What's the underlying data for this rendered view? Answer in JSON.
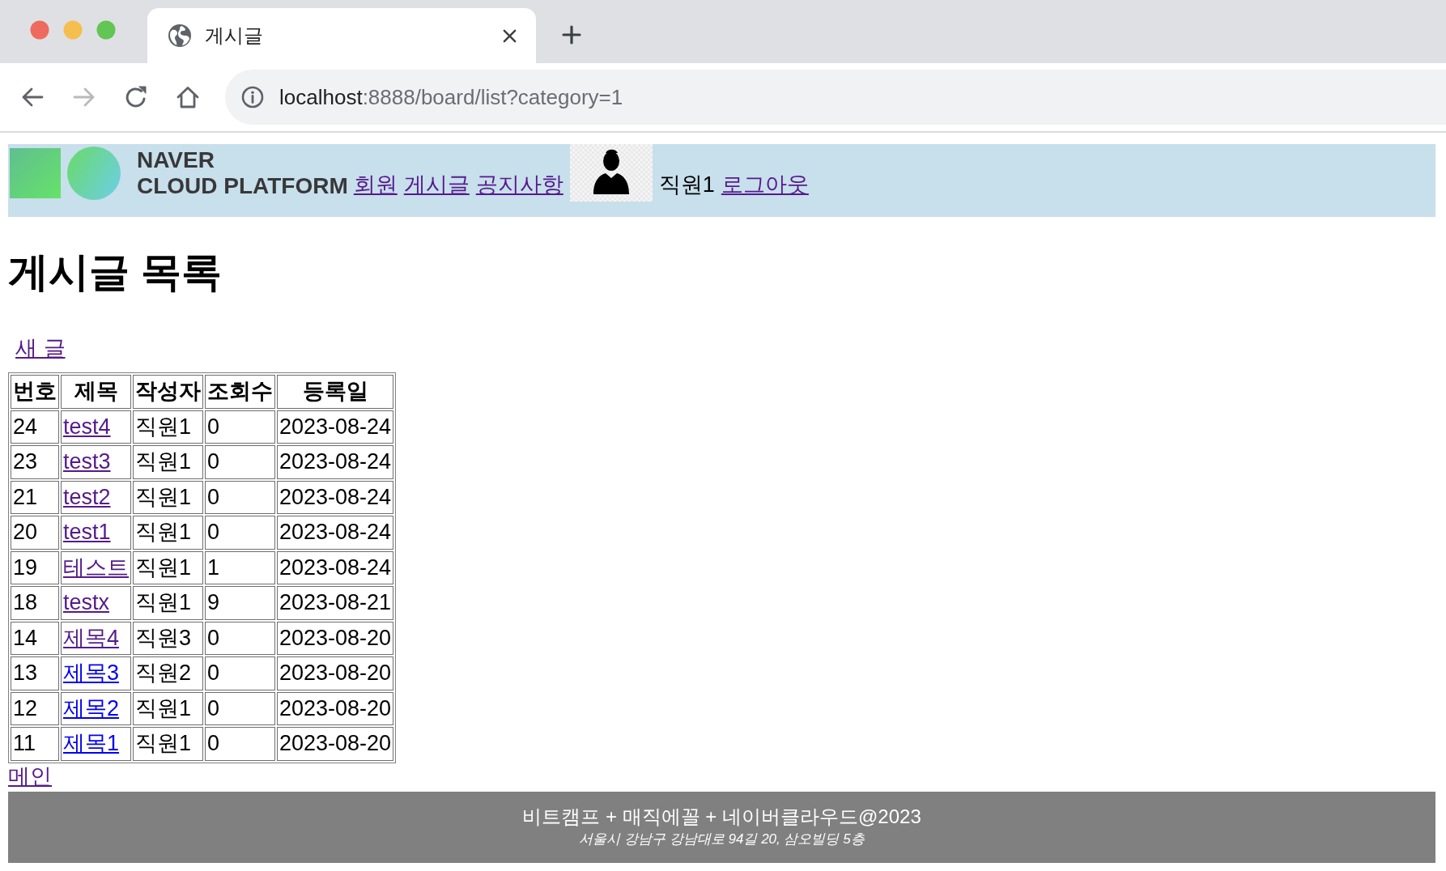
{
  "browser": {
    "tabs": [
      {
        "title": "게시글",
        "selected": true
      }
    ],
    "nav_buttons": [
      {
        "kind": "back",
        "disabled": false
      },
      {
        "kind": "forward",
        "disabled": true
      },
      {
        "kind": "reload",
        "disabled": false
      },
      {
        "kind": "home",
        "disabled": false
      }
    ],
    "address": {
      "host": "localhost",
      "path": ":8888/board/list?category=1"
    }
  },
  "header": {
    "logo": [
      "NAVER",
      "CLOUD PLATFORM"
    ],
    "nav_links": [
      "회원",
      "게시글",
      "공지사항"
    ],
    "user_name": "직원1",
    "logout": "로그아웃"
  },
  "title": "게시글 목록",
  "new_post_link": "새 글",
  "table": {
    "columns": [
      "번호",
      "제목",
      "작성자",
      "조회수",
      "등록일"
    ],
    "rows": [
      {
        "no": "24",
        "title": "test4",
        "visited": true,
        "writer": "직원1",
        "views": "0",
        "date": "2023-08-24"
      },
      {
        "no": "23",
        "title": "test3",
        "visited": true,
        "writer": "직원1",
        "views": "0",
        "date": "2023-08-24"
      },
      {
        "no": "21",
        "title": "test2",
        "visited": true,
        "writer": "직원1",
        "views": "0",
        "date": "2023-08-24"
      },
      {
        "no": "20",
        "title": "test1",
        "visited": true,
        "writer": "직원1",
        "views": "0",
        "date": "2023-08-24"
      },
      {
        "no": "19",
        "title": "테스트",
        "visited": true,
        "writer": "직원1",
        "views": "1",
        "date": "2023-08-24"
      },
      {
        "no": "18",
        "title": "testx",
        "visited": true,
        "writer": "직원1",
        "views": "9",
        "date": "2023-08-21"
      },
      {
        "no": "14",
        "title": "제목4",
        "visited": true,
        "writer": "직원3",
        "views": "0",
        "date": "2023-08-20"
      },
      {
        "no": "13",
        "title": "제목3",
        "visited": false,
        "writer": "직원2",
        "views": "0",
        "date": "2023-08-20"
      },
      {
        "no": "12",
        "title": "제목2",
        "visited": false,
        "writer": "직원1",
        "views": "0",
        "date": "2023-08-20"
      },
      {
        "no": "11",
        "title": "제목1",
        "visited": false,
        "writer": "직원1",
        "views": "0",
        "date": "2023-08-20"
      }
    ]
  },
  "main_link": "메인",
  "footer": {
    "line1": "비트캠프 + 매직에꼴 + 네이버클라우드@2023",
    "line2": "서울시 강남구 강남대로 94길 20, 삼오빌딩 5층"
  }
}
